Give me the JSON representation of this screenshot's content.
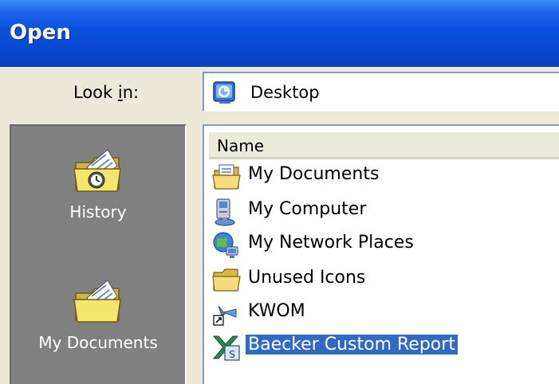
{
  "window": {
    "title": "Open"
  },
  "look_in": {
    "label": "Look in:",
    "value": "Desktop",
    "icon": "desktop-icon"
  },
  "places": [
    {
      "label": "History",
      "icon": "history-folder-icon"
    },
    {
      "label": "My Documents",
      "icon": "my-documents-folder-icon"
    }
  ],
  "file_list": {
    "column_header": "Name",
    "items": [
      {
        "name": "My Documents",
        "icon": "my-documents-icon",
        "selected": false
      },
      {
        "name": "My Computer",
        "icon": "my-computer-icon",
        "selected": false
      },
      {
        "name": "My Network Places",
        "icon": "network-places-icon",
        "selected": false
      },
      {
        "name": "Unused Icons",
        "icon": "folder-icon",
        "selected": false
      },
      {
        "name": "KWOM",
        "icon": "shortcut-icon",
        "selected": false
      },
      {
        "name": "Baecker Custom Report",
        "icon": "excel-file-icon",
        "selected": true
      }
    ]
  },
  "colors": {
    "titlebar": "#0a4fdc",
    "selection": "#316ac5",
    "places_bar": "#808080",
    "dialog_bg": "#ece9d8"
  }
}
